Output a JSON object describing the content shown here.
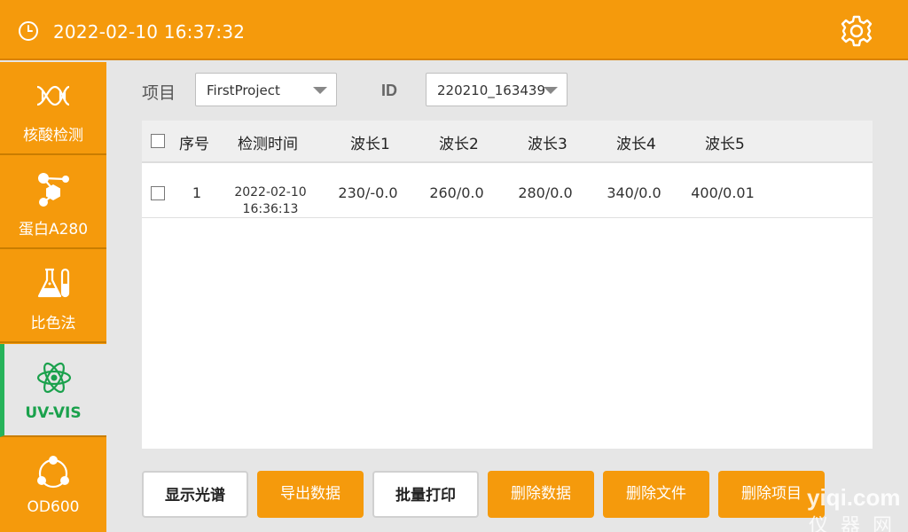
{
  "header": {
    "datetime": "2022-02-10 16:37:32",
    "clock_icon": "clock-icon",
    "settings_icon": "gear-icon"
  },
  "sidebar": {
    "items": [
      {
        "label": "核酸检测",
        "icon": "dna-icon",
        "active": false
      },
      {
        "label": "蛋白A280",
        "icon": "molecule-icon",
        "active": false
      },
      {
        "label": "比色法",
        "icon": "flask-icon",
        "active": false
      },
      {
        "label": "UV-VIS",
        "icon": "atom-icon",
        "active": true
      },
      {
        "label": "OD600",
        "icon": "cells-icon",
        "active": false
      }
    ]
  },
  "filters": {
    "project_label": "项目",
    "project_value": "FirstProject",
    "id_label": "ID",
    "id_value": "220210_163439"
  },
  "table": {
    "headers": [
      "序号",
      "检测时间",
      "波长1",
      "波长2",
      "波长3",
      "波长4",
      "波长5"
    ],
    "rows": [
      {
        "index": "1",
        "date": "2022-02-10",
        "time": "16:36:13",
        "w1": "230/-0.0",
        "w2": "260/0.0",
        "w3": "280/0.0",
        "w4": "340/0.0",
        "w5": "400/0.01"
      }
    ]
  },
  "buttons": {
    "show_spectrum": "显示光谱",
    "export_data": "导出数据",
    "batch_print": "批量打印",
    "delete_data": "删除数据",
    "delete_file": "删除文件",
    "delete_project": "删除项目"
  },
  "watermark": {
    "line1": "yiqi.com",
    "line2": "仪器网"
  },
  "colors": {
    "accent": "#f59a0c",
    "active": "#27b35a"
  }
}
